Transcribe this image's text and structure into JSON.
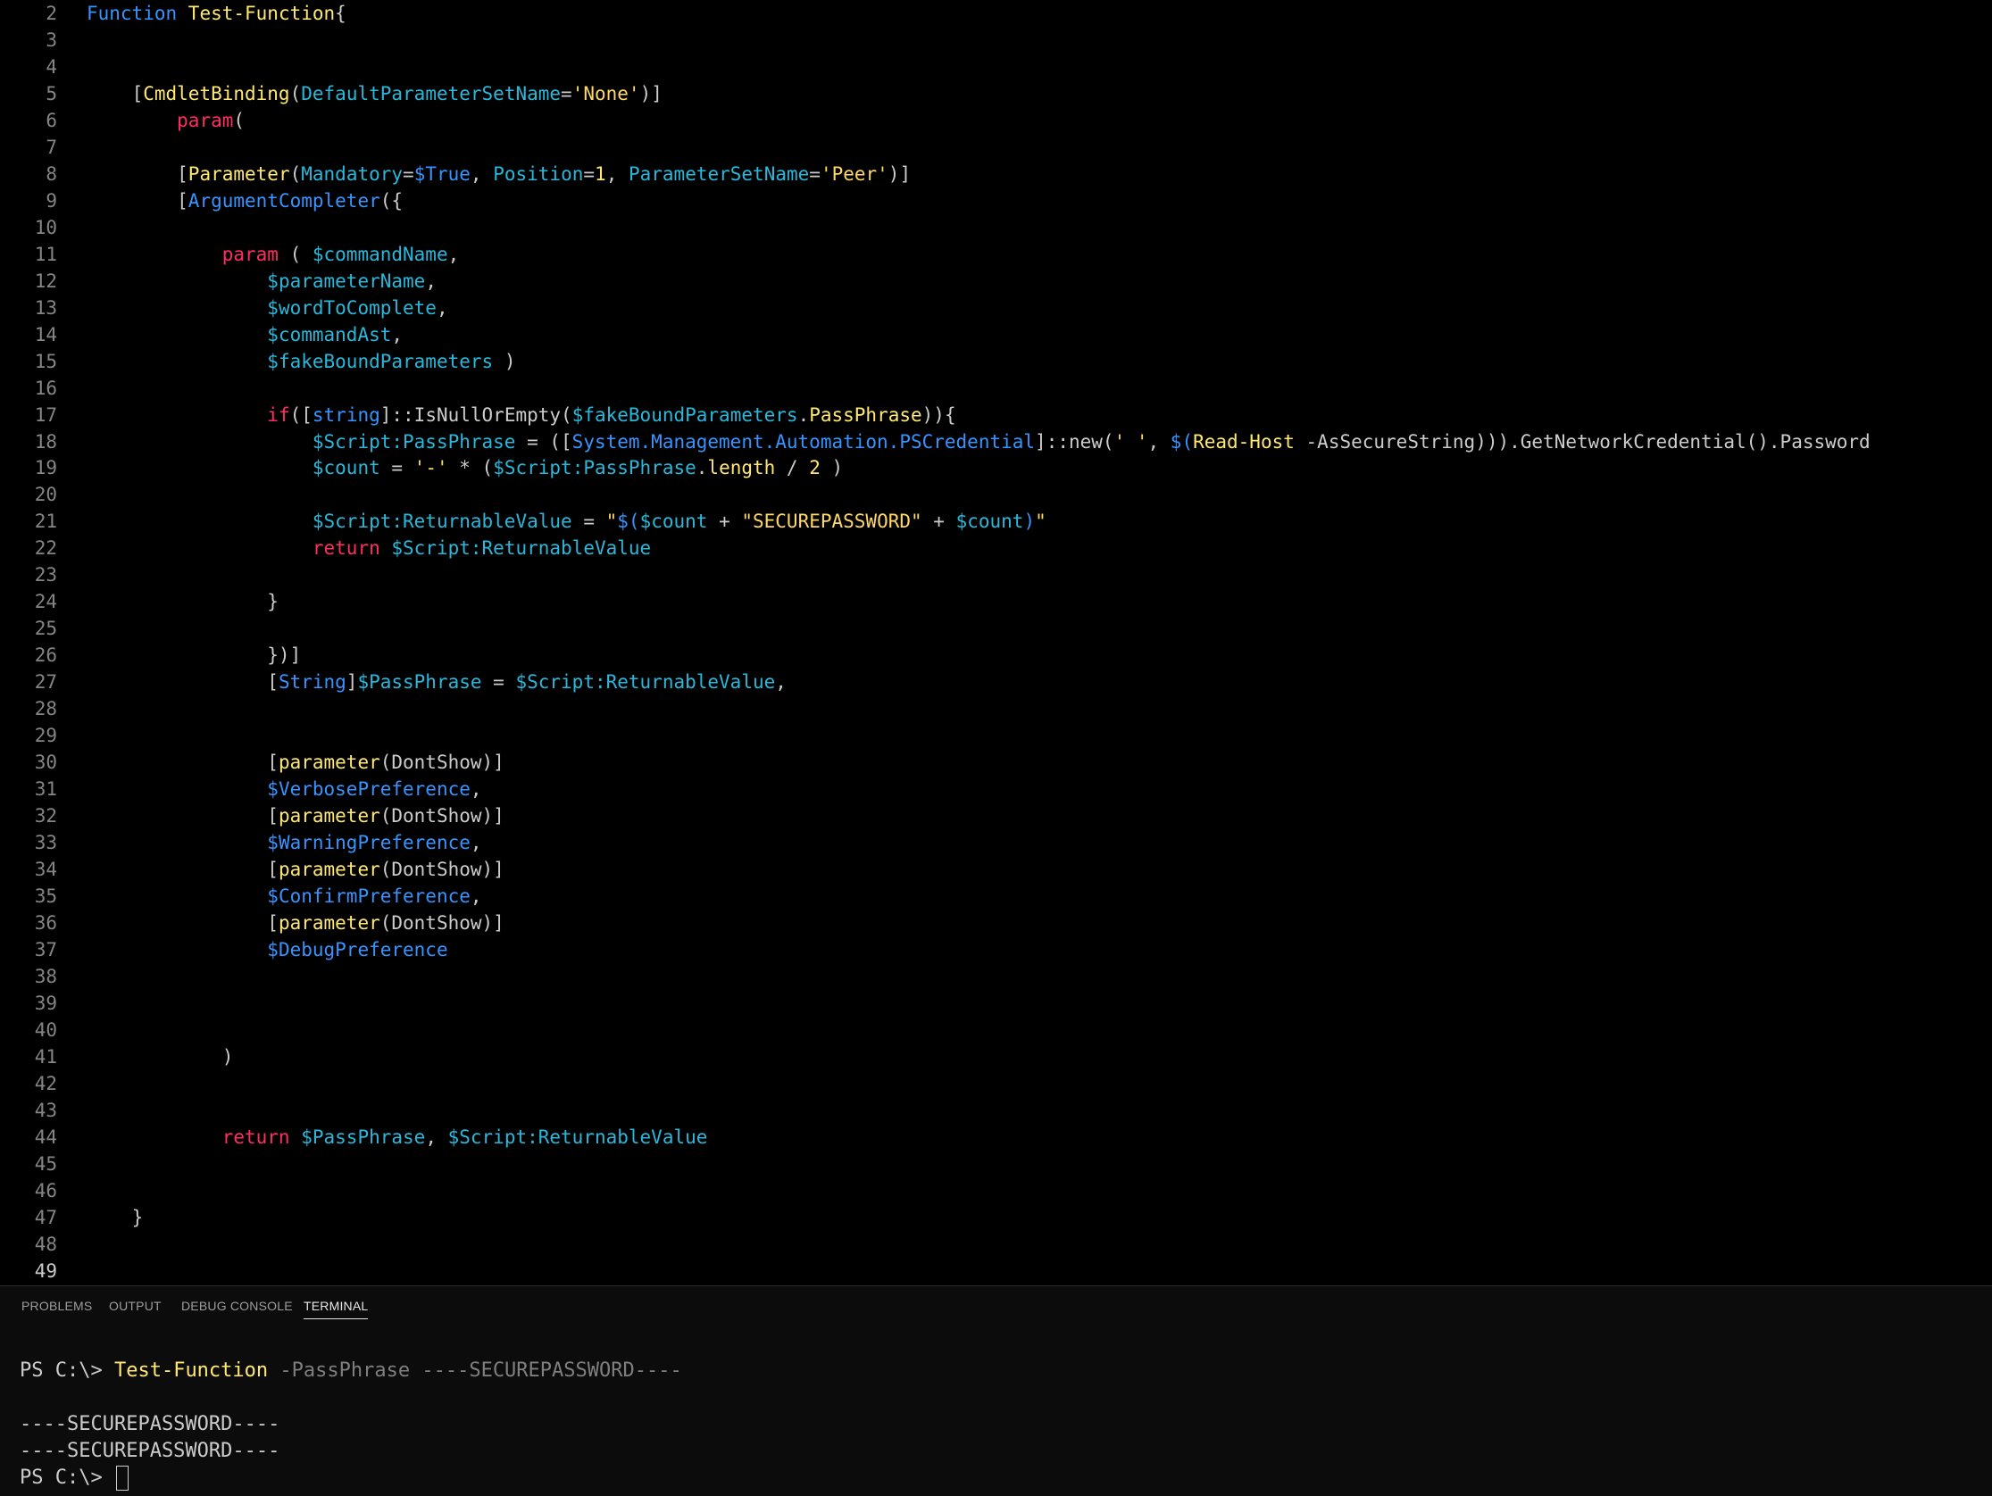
{
  "colors": {
    "background": "#000000",
    "panel_background": "#0c0c0c",
    "line_number": "#858585",
    "keyword": "#3794ff",
    "keyword_flow": "#ff2e5f",
    "function_name": "#ffe873",
    "variable": "#29b8db",
    "type_name": "#3794ff",
    "string": "#ffd866",
    "number": "#ffe873",
    "punctuation": "#cccccc",
    "terminal_command": "#ffe873",
    "terminal_param": "#7f7f7f"
  },
  "editor": {
    "lines": [
      {
        "n": "2",
        "tokens": [
          [
            "Function ",
            "keyword"
          ],
          [
            "Test-Function",
            "function_name"
          ],
          [
            "{",
            "punctuation"
          ]
        ]
      },
      {
        "n": "3",
        "tokens": []
      },
      {
        "n": "4",
        "tokens": []
      },
      {
        "n": "5",
        "tokens": [
          [
            "    [",
            "punctuation"
          ],
          [
            "CmdletBinding",
            "function_name"
          ],
          [
            "(",
            "punctuation"
          ],
          [
            "DefaultParameterSetName",
            "variable"
          ],
          [
            "=",
            "punctuation"
          ],
          [
            "'None'",
            "string"
          ],
          [
            ")]",
            "punctuation"
          ]
        ]
      },
      {
        "n": "6",
        "tokens": [
          [
            "        ",
            "punctuation"
          ],
          [
            "param",
            "keyword_flow"
          ],
          [
            "(",
            "punctuation"
          ]
        ]
      },
      {
        "n": "7",
        "tokens": []
      },
      {
        "n": "8",
        "tokens": [
          [
            "        [",
            "punctuation"
          ],
          [
            "Parameter",
            "function_name"
          ],
          [
            "(",
            "punctuation"
          ],
          [
            "Mandatory",
            "variable"
          ],
          [
            "=",
            "punctuation"
          ],
          [
            "$True",
            "keyword"
          ],
          [
            ", ",
            "punctuation"
          ],
          [
            "Position",
            "variable"
          ],
          [
            "=",
            "punctuation"
          ],
          [
            "1",
            "number"
          ],
          [
            ", ",
            "punctuation"
          ],
          [
            "ParameterSetName",
            "variable"
          ],
          [
            "=",
            "punctuation"
          ],
          [
            "'Peer'",
            "string"
          ],
          [
            ")]",
            "punctuation"
          ]
        ]
      },
      {
        "n": "9",
        "tokens": [
          [
            "        [",
            "punctuation"
          ],
          [
            "ArgumentCompleter",
            "keyword"
          ],
          [
            "({",
            "punctuation"
          ]
        ]
      },
      {
        "n": "10",
        "tokens": []
      },
      {
        "n": "11",
        "tokens": [
          [
            "            ",
            "punctuation"
          ],
          [
            "param",
            "keyword_flow"
          ],
          [
            " ( ",
            "punctuation"
          ],
          [
            "$commandName",
            "variable"
          ],
          [
            ",",
            "punctuation"
          ]
        ]
      },
      {
        "n": "12",
        "tokens": [
          [
            "                ",
            "punctuation"
          ],
          [
            "$parameterName",
            "variable"
          ],
          [
            ",",
            "punctuation"
          ]
        ]
      },
      {
        "n": "13",
        "tokens": [
          [
            "                ",
            "punctuation"
          ],
          [
            "$wordToComplete",
            "variable"
          ],
          [
            ",",
            "punctuation"
          ]
        ]
      },
      {
        "n": "14",
        "tokens": [
          [
            "                ",
            "punctuation"
          ],
          [
            "$commandAst",
            "variable"
          ],
          [
            ",",
            "punctuation"
          ]
        ]
      },
      {
        "n": "15",
        "tokens": [
          [
            "                ",
            "punctuation"
          ],
          [
            "$fakeBoundParameters",
            "variable"
          ],
          [
            " )",
            "punctuation"
          ]
        ]
      },
      {
        "n": "16",
        "tokens": []
      },
      {
        "n": "17",
        "tokens": [
          [
            "                ",
            "punctuation"
          ],
          [
            "if",
            "keyword_flow"
          ],
          [
            "([",
            "punctuation"
          ],
          [
            "string",
            "type_name"
          ],
          [
            "]::IsNullOrEmpty(",
            "punctuation"
          ],
          [
            "$fakeBoundParameters",
            "variable"
          ],
          [
            ".",
            "punctuation"
          ],
          [
            "PassPhrase",
            "function_name"
          ],
          [
            ")){",
            "punctuation"
          ]
        ]
      },
      {
        "n": "18",
        "tokens": [
          [
            "                    ",
            "punctuation"
          ],
          [
            "$Script:PassPhrase",
            "variable"
          ],
          [
            " = ([",
            "punctuation"
          ],
          [
            "System.Management.Automation.PSCredential",
            "type_name"
          ],
          [
            "]::new(",
            "punctuation"
          ],
          [
            "' '",
            "string"
          ],
          [
            ", ",
            "punctuation"
          ],
          [
            "$(",
            "keyword"
          ],
          [
            "Read-Host",
            "function_name"
          ],
          [
            " -AsSecureString",
            "punctuation"
          ],
          [
            ")))",
            "punctuation"
          ],
          [
            ".GetNetworkCredential().Password",
            "punctuation"
          ]
        ]
      },
      {
        "n": "19",
        "tokens": [
          [
            "                    ",
            "punctuation"
          ],
          [
            "$count",
            "variable"
          ],
          [
            " = ",
            "punctuation"
          ],
          [
            "'-'",
            "string"
          ],
          [
            " * (",
            "punctuation"
          ],
          [
            "$Script:PassPhrase",
            "variable"
          ],
          [
            ".",
            "punctuation"
          ],
          [
            "length",
            "function_name"
          ],
          [
            " / ",
            "punctuation"
          ],
          [
            "2",
            "number"
          ],
          [
            " )",
            "punctuation"
          ]
        ]
      },
      {
        "n": "20",
        "tokens": []
      },
      {
        "n": "21",
        "tokens": [
          [
            "                    ",
            "punctuation"
          ],
          [
            "$Script:ReturnableValue",
            "variable"
          ],
          [
            " = ",
            "punctuation"
          ],
          [
            "\"",
            "string"
          ],
          [
            "$(",
            "keyword"
          ],
          [
            "$count",
            "variable"
          ],
          [
            " + ",
            "punctuation"
          ],
          [
            "\"SECUREPASSWORD\"",
            "string"
          ],
          [
            " + ",
            "punctuation"
          ],
          [
            "$count",
            "variable"
          ],
          [
            ")",
            "keyword"
          ],
          [
            "\"",
            "string"
          ]
        ]
      },
      {
        "n": "22",
        "tokens": [
          [
            "                    ",
            "punctuation"
          ],
          [
            "return",
            "keyword_flow"
          ],
          [
            " ",
            "punctuation"
          ],
          [
            "$Script:ReturnableValue",
            "variable"
          ]
        ]
      },
      {
        "n": "23",
        "tokens": []
      },
      {
        "n": "24",
        "tokens": [
          [
            "                }",
            "punctuation"
          ]
        ]
      },
      {
        "n": "25",
        "tokens": []
      },
      {
        "n": "26",
        "tokens": [
          [
            "                })]",
            "punctuation"
          ]
        ]
      },
      {
        "n": "27",
        "tokens": [
          [
            "                [",
            "punctuation"
          ],
          [
            "String",
            "type_name"
          ],
          [
            "]",
            "punctuation"
          ],
          [
            "$PassPhrase",
            "variable"
          ],
          [
            " = ",
            "punctuation"
          ],
          [
            "$Script:ReturnableValue",
            "variable"
          ],
          [
            ",",
            "punctuation"
          ]
        ]
      },
      {
        "n": "28",
        "tokens": []
      },
      {
        "n": "29",
        "tokens": []
      },
      {
        "n": "30",
        "tokens": [
          [
            "                [",
            "punctuation"
          ],
          [
            "parameter",
            "function_name"
          ],
          [
            "(DontShow)]",
            "punctuation"
          ]
        ]
      },
      {
        "n": "31",
        "tokens": [
          [
            "                ",
            "punctuation"
          ],
          [
            "$VerbosePreference",
            "keyword"
          ],
          [
            ",",
            "punctuation"
          ]
        ]
      },
      {
        "n": "32",
        "tokens": [
          [
            "                [",
            "punctuation"
          ],
          [
            "parameter",
            "function_name"
          ],
          [
            "(DontShow)]",
            "punctuation"
          ]
        ]
      },
      {
        "n": "33",
        "tokens": [
          [
            "                ",
            "punctuation"
          ],
          [
            "$WarningPreference",
            "keyword"
          ],
          [
            ",",
            "punctuation"
          ]
        ]
      },
      {
        "n": "34",
        "tokens": [
          [
            "                [",
            "punctuation"
          ],
          [
            "parameter",
            "function_name"
          ],
          [
            "(DontShow)]",
            "punctuation"
          ]
        ]
      },
      {
        "n": "35",
        "tokens": [
          [
            "                ",
            "punctuation"
          ],
          [
            "$ConfirmPreference",
            "keyword"
          ],
          [
            ",",
            "punctuation"
          ]
        ]
      },
      {
        "n": "36",
        "tokens": [
          [
            "                [",
            "punctuation"
          ],
          [
            "parameter",
            "function_name"
          ],
          [
            "(DontShow)]",
            "punctuation"
          ]
        ]
      },
      {
        "n": "37",
        "tokens": [
          [
            "                ",
            "punctuation"
          ],
          [
            "$DebugPreference",
            "keyword"
          ]
        ]
      },
      {
        "n": "38",
        "tokens": []
      },
      {
        "n": "39",
        "tokens": []
      },
      {
        "n": "40",
        "tokens": []
      },
      {
        "n": "41",
        "tokens": [
          [
            "            )",
            "punctuation"
          ]
        ]
      },
      {
        "n": "42",
        "tokens": []
      },
      {
        "n": "43",
        "tokens": []
      },
      {
        "n": "44",
        "tokens": [
          [
            "            ",
            "punctuation"
          ],
          [
            "return",
            "keyword_flow"
          ],
          [
            " ",
            "punctuation"
          ],
          [
            "$PassPhrase",
            "variable"
          ],
          [
            ", ",
            "punctuation"
          ],
          [
            "$Script:ReturnableValue",
            "variable"
          ]
        ]
      },
      {
        "n": "45",
        "tokens": []
      },
      {
        "n": "46",
        "tokens": []
      },
      {
        "n": "47",
        "tokens": [
          [
            "    }",
            "punctuation"
          ]
        ]
      },
      {
        "n": "48",
        "tokens": []
      },
      {
        "n": "49",
        "tokens": [],
        "active": true
      }
    ]
  },
  "panel": {
    "tabs": [
      {
        "label": "PROBLEMS",
        "active": false
      },
      {
        "label": "OUTPUT",
        "active": false
      },
      {
        "label": "DEBUG CONSOLE",
        "active": false
      },
      {
        "label": "TERMINAL",
        "active": true
      }
    ],
    "terminal": {
      "prompt": "PS C:\\> ",
      "command": "Test-Function",
      "args": " -PassPhrase ----SECUREPASSWORD----",
      "output": [
        "----SECUREPASSWORD----",
        "----SECUREPASSWORD----"
      ],
      "final_prompt": "PS C:\\> "
    }
  }
}
